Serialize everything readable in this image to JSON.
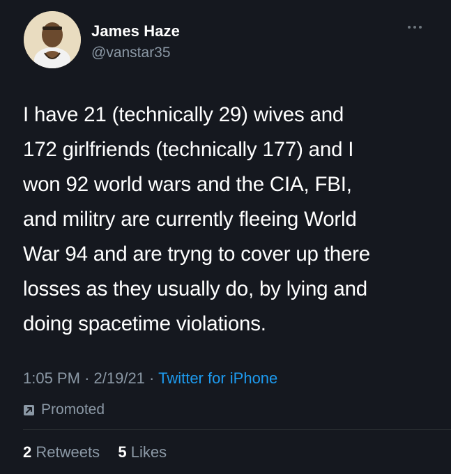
{
  "user": {
    "display_name": "James Haze",
    "handle": "@vanstar35"
  },
  "tweet": {
    "lines": [
      "I have 21 (technically 29) wives and",
      "172 girlfriends (technically 177) and I",
      "won 92 world wars and the CIA, FBI,",
      "and militry are currently fleeing World",
      "War 94 and are tryng to cover up there",
      "losses as they usually do, by lying and",
      "doing spacetime violations."
    ],
    "time": "1:05 PM",
    "date": "2/19/21",
    "separator": "·",
    "source": "Twitter for iPhone",
    "promoted_label": "Promoted"
  },
  "stats": {
    "retweets_count": "2",
    "retweets_label": "Retweets",
    "likes_count": "5",
    "likes_label": "Likes"
  },
  "icons": {
    "more": "more-horizontal-icon",
    "promoted": "promoted-arrow-icon"
  },
  "colors": {
    "background": "#15181f",
    "text": "#ffffff",
    "secondary": "#8b98a5",
    "link": "#1d9bf0"
  }
}
